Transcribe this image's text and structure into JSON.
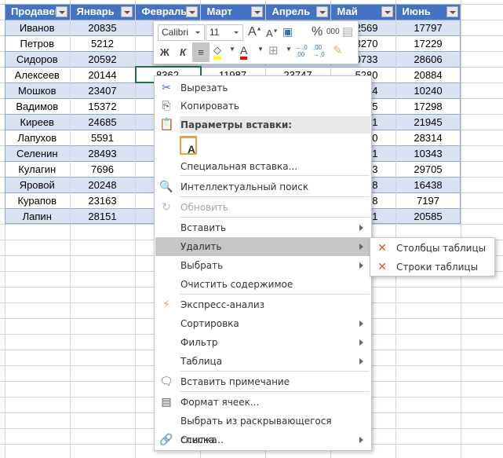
{
  "table": {
    "headers": [
      "Продавец",
      "Январь",
      "Февраль",
      "Март",
      "Апрель",
      "Май",
      "Июнь"
    ],
    "rows": [
      [
        "Иванов",
        "20835",
        "",
        "",
        "",
        "2569",
        "17797"
      ],
      [
        "Петров",
        "5212",
        "",
        "",
        "",
        "3270",
        "17229"
      ],
      [
        "Сидоров",
        "20592",
        "",
        "",
        "",
        "0733",
        "28606"
      ],
      [
        "Алексеев",
        "20144",
        "8362",
        "11987",
        "23747",
        "5280",
        "20884"
      ],
      [
        "Мошков",
        "23407",
        "",
        "",
        "",
        "4",
        "10240"
      ],
      [
        "Вадимов",
        "15372",
        "",
        "",
        "",
        "5",
        "17298"
      ],
      [
        "Киреев",
        "24685",
        "",
        "",
        "",
        "1",
        "21945"
      ],
      [
        "Лапухов",
        "5591",
        "",
        "",
        "",
        "0",
        "28314"
      ],
      [
        "Селенин",
        "28493",
        "",
        "",
        "",
        "1",
        "10343"
      ],
      [
        "Кулагин",
        "7696",
        "",
        "",
        "",
        "3",
        "29705"
      ],
      [
        "Яровой",
        "20248",
        "",
        "",
        "",
        "8",
        "16438"
      ],
      [
        "Курапов",
        "23163",
        "",
        "",
        "",
        "8",
        "7197"
      ],
      [
        "Лапин",
        "28151",
        "",
        "",
        "",
        "1",
        "20585"
      ]
    ]
  },
  "mini_toolbar": {
    "font": "Calibri",
    "size": "11",
    "bold": "Ж",
    "italic": "К",
    "percent": "%",
    "thousands": "000",
    "dec_inc": "←,0 ,00",
    "dec_dec": ",00 →,0"
  },
  "menu": {
    "cut": "Вырезать",
    "copy": "Копировать",
    "paste_header": "Параметры вставки:",
    "paste_special": "Специальная вставка...",
    "smart_lookup": "Интеллектуальный поиск",
    "refresh": "Обновить",
    "insert": "Вставить",
    "delete": "Удалить",
    "select": "Выбрать",
    "clear": "Очистить содержимое",
    "quick_analysis": "Экспресс-анализ",
    "sort": "Сортировка",
    "filter": "Фильтр",
    "table": "Таблица",
    "insert_comment": "Вставить примечание",
    "format_cells": "Формат ячеек...",
    "pick_list": "Выбрать из раскрывающегося списка...",
    "link": "Ссылка"
  },
  "submenu": {
    "columns": "Столбцы таблицы",
    "rows": "Строки таблицы"
  },
  "colors": {
    "header": "#4472c4",
    "band": "#d9e1f2",
    "selection": "#217346"
  }
}
